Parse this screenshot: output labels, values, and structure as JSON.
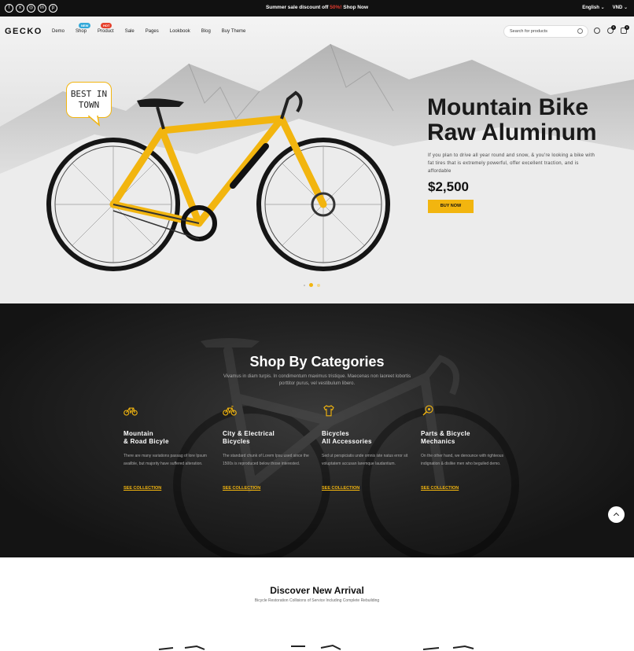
{
  "topbar": {
    "socials": [
      "facebook-icon",
      "x-icon",
      "instagram-icon",
      "linkedin-icon",
      "pinterest-icon"
    ],
    "promo_prefix": "Summer sale discount off",
    "promo_highlight": "50%!",
    "promo_cta": "Shop Now",
    "language": "English",
    "currency": "VND"
  },
  "header": {
    "logo": "GECKO",
    "nav": [
      {
        "label": "Demo",
        "badge": ""
      },
      {
        "label": "Shop",
        "badge": "NEW"
      },
      {
        "label": "Product",
        "badge": "HOT"
      },
      {
        "label": "Sale",
        "badge": ""
      },
      {
        "label": "Pages",
        "badge": ""
      },
      {
        "label": "Lookbook",
        "badge": ""
      },
      {
        "label": "Blog",
        "badge": ""
      },
      {
        "label": "Buy Theme",
        "badge": ""
      }
    ],
    "search_placeholder": "Search for products",
    "wishlist_count": "0",
    "cart_count": "0"
  },
  "hero": {
    "bubble": "BEST IN TOWN",
    "title_line1": "Mountain Bike",
    "title_line2": "Raw Aluminum",
    "description": "If you plan to drive all year round and snow, & you're looking a bike with fat tires that is extremely powerful, offer excellent traction, and is affordable",
    "price": "$2,500",
    "cta": "BUY NOW",
    "slides": 3,
    "active_slide": 2
  },
  "categories": {
    "title": "Shop By Categories",
    "subtitle": "Vivamus in diam turpis. In condimentum maximus tristique. Maecenas non laoreet lobortis porttitor purus, vel vestibulum libero.",
    "items": [
      {
        "line1": "Mountain",
        "line2": "& Road Bicyle",
        "desc": "There are many variations passag of lore Ipsum availble, but majority have suffered alteration.",
        "link": "SEE COLLECTION",
        "icon": "bicycle-icon"
      },
      {
        "line1": "City & Electrical",
        "line2": "Bicycles",
        "desc": "The standard chunk of Lorem Ipsu used since the 1500s is reproduced below those interested.",
        "link": "SEE COLLECTION",
        "icon": "electric-bicycle-icon"
      },
      {
        "line1": "Bicycles",
        "line2": "All Accessories",
        "desc": "Sed ut perspiciatis unde omnis iste natus error sit voluptatem accusan laremque laudantium.",
        "link": "SEE COLLECTION",
        "icon": "jersey-icon"
      },
      {
        "line1": "Parts & Bicycle",
        "line2": "Mechanics",
        "desc": "On the other hand, we denounce with righteous indignation & dislike men who beguiled demo.",
        "link": "SEE COLLECTION",
        "icon": "wrench-icon"
      }
    ]
  },
  "arrival": {
    "title": "Discover New Arrival",
    "subtitle": "Bicycle Restoration Collisions of Service Including Complete Rebuilding"
  },
  "colors": {
    "accent": "#f2b50f",
    "dark": "#141414"
  }
}
